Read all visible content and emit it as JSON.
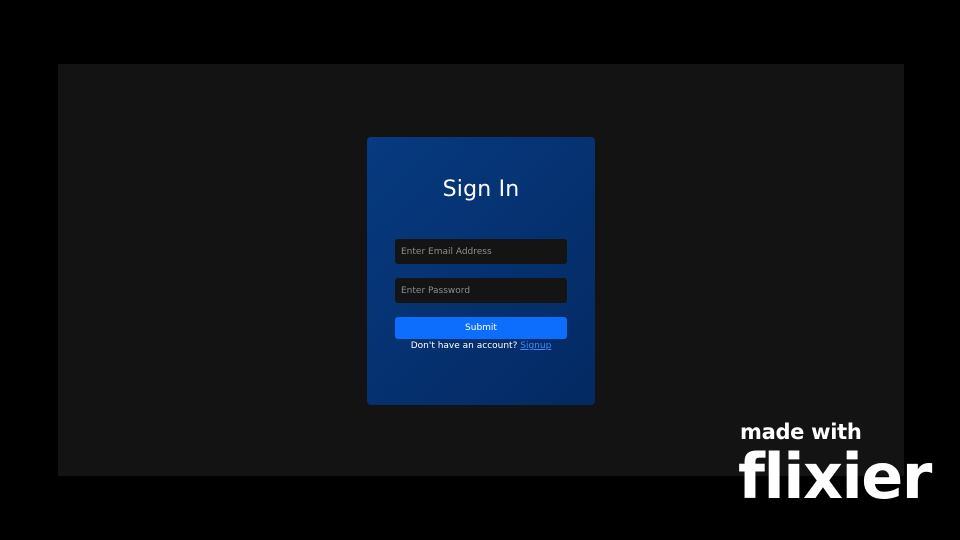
{
  "login": {
    "title": "Sign In",
    "email": {
      "placeholder": "Enter Email Address",
      "value": ""
    },
    "password": {
      "placeholder": "Enter Password",
      "value": ""
    },
    "submit_label": "Submit",
    "signup_prompt": "Don't have an account? ",
    "signup_link": "Signup"
  },
  "watermark": {
    "line1": "made with",
    "line2": "flixier"
  },
  "colors": {
    "outer_background": "#000000",
    "stage_background": "#131313",
    "card_background": "#06357a",
    "input_background": "#141414",
    "button_background": "#0d6efd",
    "link": "#3d8bff",
    "text": "#ffffff"
  }
}
